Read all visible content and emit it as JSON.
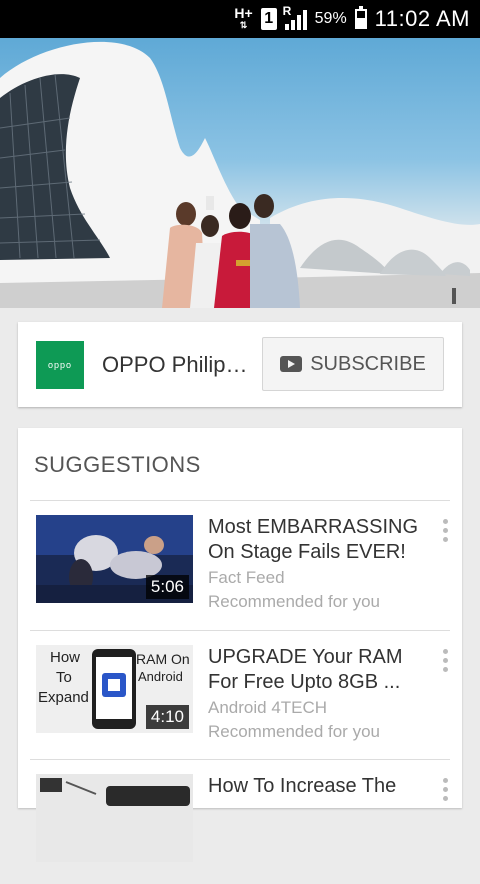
{
  "status_bar": {
    "network": "H+",
    "sim": "1",
    "roaming": "R",
    "battery_percent": "59%",
    "battery_level": 0.59,
    "time": "11:02 AM"
  },
  "channel": {
    "logo_text": "oppo",
    "name": "OPPO Philippines",
    "subscribe_label": "SUBSCRIBE",
    "logo_color": "#0e9a55"
  },
  "suggestions": {
    "title": "SUGGESTIONS",
    "videos": [
      {
        "title": "Most EMBARRASSING On Stage Fails EVER!",
        "channel": "Fact Feed",
        "note": "Recommended for you",
        "duration": "5:06"
      },
      {
        "title": "UPGRADE  Your RAM For Free Upto 8GB  ...",
        "channel": "Android 4TECH",
        "note": "Recommended for you",
        "duration": "4:10",
        "thumb_text": [
          "How",
          "To",
          "Expand",
          "RAM On",
          "Android"
        ]
      },
      {
        "title": "How To Increase The",
        "channel": "",
        "note": "",
        "duration": ""
      }
    ]
  }
}
